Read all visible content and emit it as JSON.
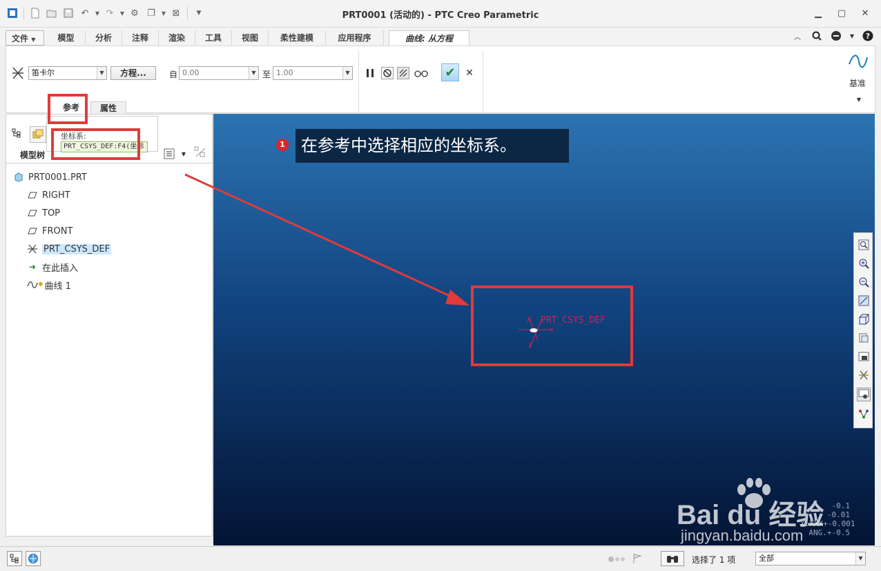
{
  "window": {
    "title": "PRT0001 (活动的) - PTC Creo Parametric"
  },
  "ribbon_tabs": [
    {
      "label": "文件"
    },
    {
      "label": "模型"
    },
    {
      "label": "分析"
    },
    {
      "label": "注释"
    },
    {
      "label": "渲染"
    },
    {
      "label": "工具"
    },
    {
      "label": "视图"
    },
    {
      "label": "柔性建模"
    },
    {
      "label": "应用程序"
    },
    {
      "label": "曲线: 从方程",
      "active": true
    }
  ],
  "ribbon": {
    "coord_type": "笛卡尔",
    "equation_button": "方程...",
    "from_label": "自",
    "from_value": "0.00",
    "to_label": "至",
    "to_value": "1.00",
    "datum_label": "基准",
    "subtabs": {
      "reference": "参考",
      "properties": "属性"
    }
  },
  "reference_panel": {
    "coord_sys_label": "坐标系:",
    "coord_sys_value": "PRT_CSYS_DEF:F4(坐标"
  },
  "left_panel": {
    "tab_label": "模型树",
    "tree": [
      {
        "label": "PRT0001.PRT",
        "icon": "part-icon"
      },
      {
        "label": "RIGHT",
        "icon": "datum-plane-icon"
      },
      {
        "label": "TOP",
        "icon": "datum-plane-icon"
      },
      {
        "label": "FRONT",
        "icon": "datum-plane-icon"
      },
      {
        "label": "PRT_CSYS_DEF",
        "icon": "csys-icon",
        "selected": true
      },
      {
        "label": "在此插入",
        "icon": "insert-arrow-icon"
      },
      {
        "label": "曲线 1",
        "icon": "curve-icon"
      }
    ]
  },
  "graphics": {
    "csys_label": "PRT_CSYS_DEF",
    "axis_labels": {
      "x": "x",
      "y": "X",
      "z": "z"
    },
    "precision_lines": [
      "-0.1",
      "-0.01",
      "X.XXX+-0.001",
      "ANG.+-0.5"
    ]
  },
  "callout": {
    "number": "1",
    "text": "在参考中选择相应的坐标系。"
  },
  "status_bar": {
    "selected_text": "选择了 1 项",
    "filter_value": "全部"
  },
  "watermark": {
    "brand": "Bai du 经验",
    "url": "jingyan.baidu.com"
  },
  "colors": {
    "accent_red": "#e23a3a",
    "viewport_top": "#2c74b3",
    "viewport_bottom": "#031434",
    "selection": "#cce8ff"
  }
}
